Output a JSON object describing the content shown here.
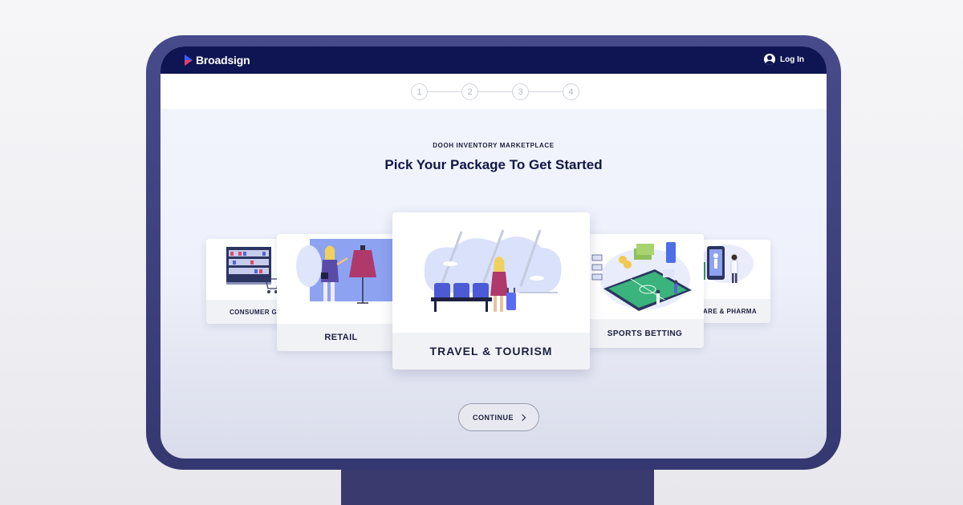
{
  "header": {
    "logo_text": "Broadsign",
    "login_label": "Log In",
    "login_icon": "user-circle-icon",
    "logo_colors": [
      "#3d5cff",
      "#e53c6a"
    ],
    "bar_color": "#0e1552"
  },
  "steps": [
    "1",
    "2",
    "3",
    "4"
  ],
  "main": {
    "eyebrow": "DOOH INVENTORY MARKETPLACE",
    "title": "Pick Your Package To Get Started"
  },
  "packages": {
    "consumer": "CONSUMER GO",
    "retail": "RETAIL",
    "travel": "TRAVEL & TOURISM",
    "sports": "SPORTS BETTING",
    "health": "ICARE & PHARMA"
  },
  "continue_label": "CONTINUE"
}
